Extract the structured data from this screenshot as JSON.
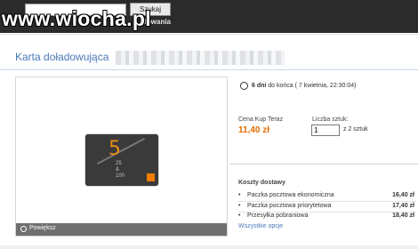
{
  "topbar": {
    "search_button_label": "Szukaj",
    "nav_label": "dowania",
    "watermark": "www.wiocha.pl"
  },
  "page_title": "Karta doładowująca",
  "image_panel": {
    "card_five": "5",
    "card_numbers": [
      "25",
      "&",
      "100"
    ],
    "zoom_label": "Powiększ"
  },
  "timer": {
    "days": "6 dni",
    "rest": " do końca ( 7 kwietnia, 22:30:04)"
  },
  "buy_now": {
    "label": "Cena Kup Teraz",
    "price": "11,40 zł"
  },
  "quantity": {
    "label": "Liczba sztuk:",
    "value": "1",
    "suffix": "z 2 sztuk"
  },
  "shipping": {
    "title": "Koszty dostawy",
    "options": [
      {
        "bullet": "•",
        "name": "Paczka pocztowa ekonomiczna",
        "price": "16,40 zł"
      },
      {
        "bullet": "•",
        "name": "Paczka pocztowa priorytetowa",
        "price": "17,40 zł"
      },
      {
        "bullet": "•",
        "name": "Przesyłka pobraniowa",
        "price": "18,40 zł"
      }
    ],
    "all_options_link": "Wszystkie opcje"
  },
  "colors": {
    "topbar": "#2b2b2b",
    "link": "#4a78b8",
    "price": "#e06a00"
  }
}
